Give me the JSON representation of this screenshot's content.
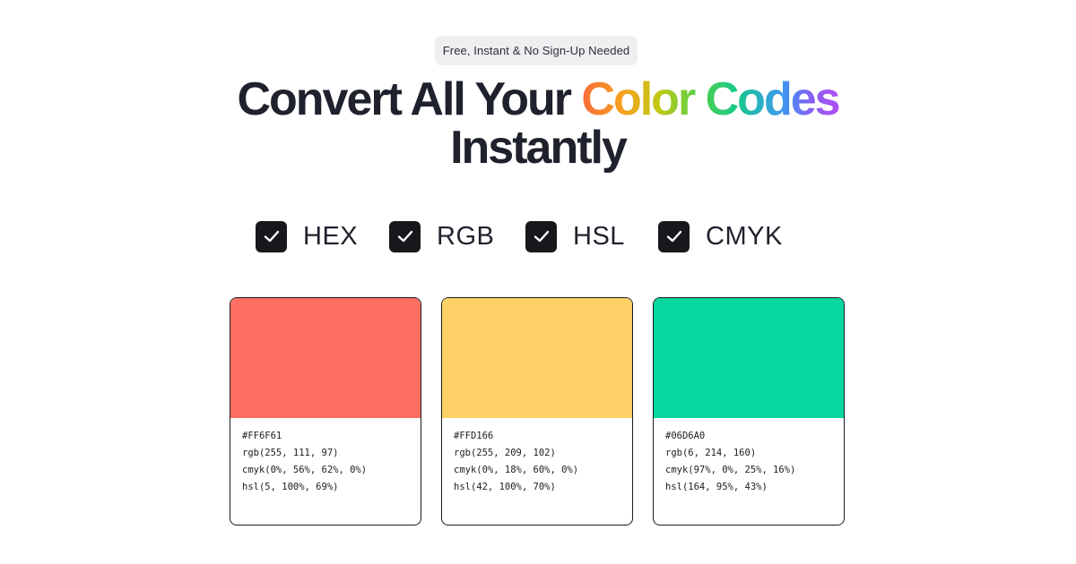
{
  "badge": {
    "text": "Free, Instant & No Sign-Up Needed"
  },
  "headline": {
    "prefix": "Convert All Your ",
    "highlight": "Color Codes",
    "line2": "Instantly"
  },
  "formats": [
    {
      "label": "HEX",
      "checked": true
    },
    {
      "label": "RGB",
      "checked": true
    },
    {
      "label": "HSL",
      "checked": true
    },
    {
      "label": "CMYK",
      "checked": true
    }
  ],
  "colors": [
    {
      "swatch": "#FF6F61",
      "hex": "#FF6F61",
      "rgb": "rgb(255, 111, 97)",
      "cmyk": "cmyk(0%, 56%, 62%, 0%)",
      "hsl": "hsl(5, 100%, 69%)"
    },
    {
      "swatch": "#FFD166",
      "hex": "#FFD166",
      "rgb": "rgb(255, 209, 102)",
      "cmyk": "cmyk(0%, 18%, 60%, 0%)",
      "hsl": "hsl(42, 100%, 70%)"
    },
    {
      "swatch": "#06D6A0",
      "hex": "#06D6A0",
      "rgb": "rgb(6, 214, 160)",
      "cmyk": "cmyk(97%, 0%, 25%, 16%)",
      "hsl": "hsl(164, 95%, 43%)"
    }
  ]
}
